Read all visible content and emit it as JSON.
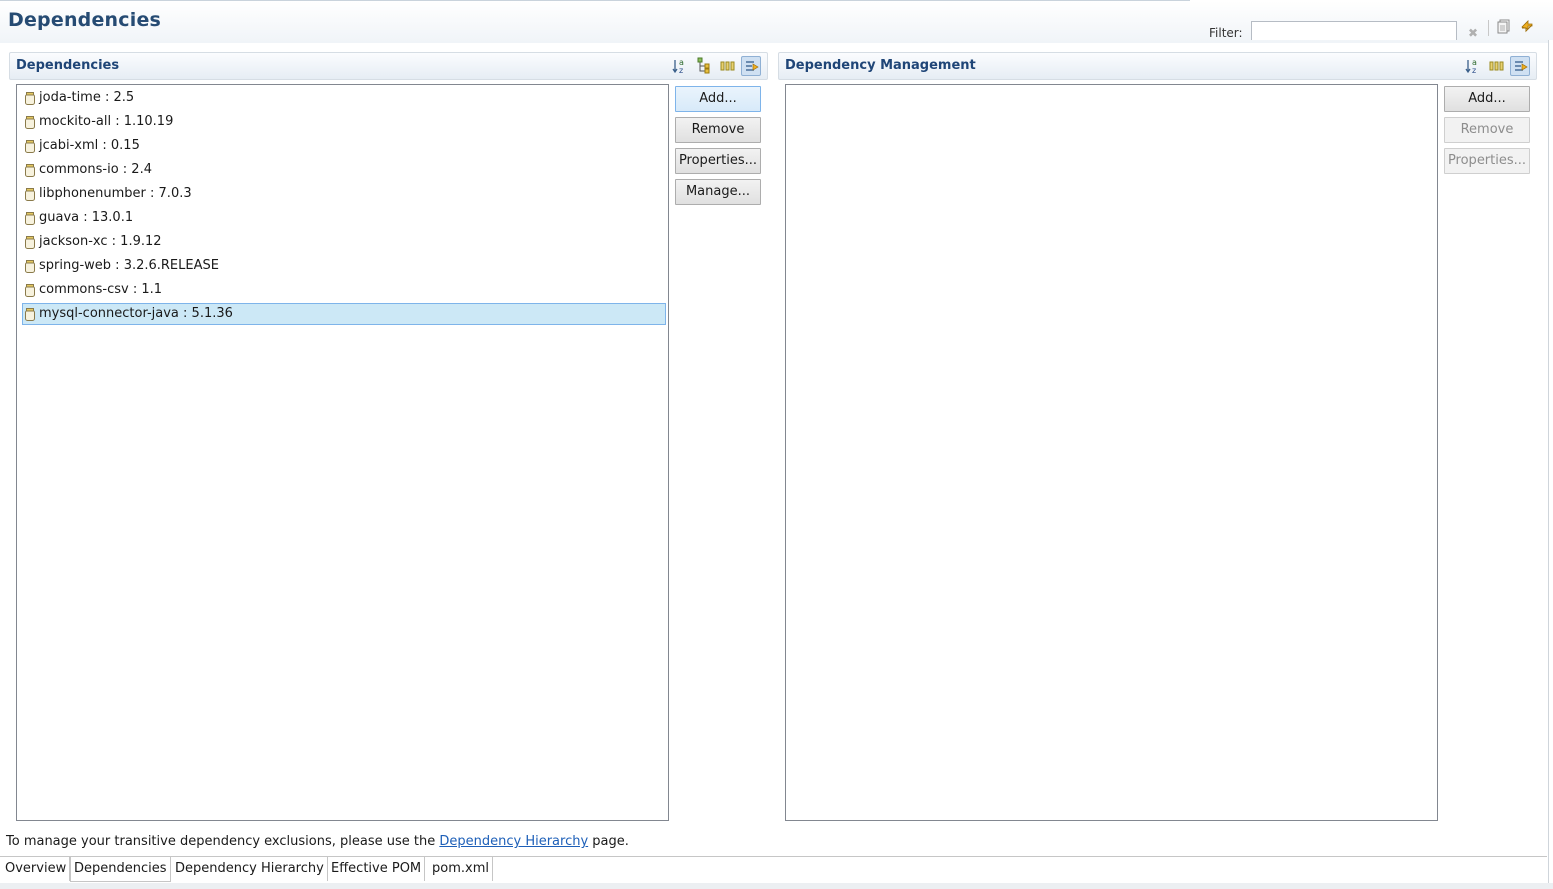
{
  "header": {
    "title": "Dependencies",
    "filter_label": "Filter:",
    "filter_value": "",
    "icons": [
      "clear-filter-icon",
      "copy-icon",
      "refresh-icon"
    ]
  },
  "dependencies_section": {
    "title": "Dependencies",
    "toolbar_icons": [
      "sort-alpha-icon",
      "show-groupid-icon",
      "columns-icon",
      "filter-toggle-icon"
    ],
    "items": [
      {
        "label": "joda-time : 2.5",
        "selected": false
      },
      {
        "label": "mockito-all : 1.10.19",
        "selected": false
      },
      {
        "label": "jcabi-xml : 0.15",
        "selected": false
      },
      {
        "label": "commons-io : 2.4",
        "selected": false
      },
      {
        "label": "libphonenumber : 7.0.3",
        "selected": false
      },
      {
        "label": "guava : 13.0.1",
        "selected": false
      },
      {
        "label": "jackson-xc : 1.9.12",
        "selected": false
      },
      {
        "label": "spring-web : 3.2.6.RELEASE",
        "selected": false
      },
      {
        "label": "commons-csv : 1.1",
        "selected": false
      },
      {
        "label": "mysql-connector-java : 5.1.36",
        "selected": true
      }
    ],
    "buttons": {
      "add": "Add...",
      "remove": "Remove",
      "properties": "Properties...",
      "manage": "Manage..."
    }
  },
  "management_section": {
    "title": "Dependency Management",
    "toolbar_icons": [
      "sort-alpha-icon",
      "columns-icon",
      "filter-toggle-icon"
    ],
    "items": [],
    "buttons": {
      "add": "Add...",
      "remove": "Remove",
      "properties": "Properties..."
    }
  },
  "footer": {
    "note_before": "To manage your transitive dependency exclusions, please use the ",
    "note_link": "Dependency Hierarchy",
    "note_after": " page.",
    "link_color": "#1d5fb8"
  },
  "tabs": [
    {
      "label": "Overview",
      "active": false
    },
    {
      "label": "Dependencies",
      "active": true
    },
    {
      "label": "Dependency Hierarchy",
      "active": false
    },
    {
      "label": "Effective POM",
      "active": false
    },
    {
      "label": "pom.xml",
      "active": false
    }
  ],
  "colors": {
    "title": "#264b73",
    "section_title": "#1f4577",
    "selection_bg": "#cce8f6",
    "selection_border": "#7eb4ea"
  }
}
